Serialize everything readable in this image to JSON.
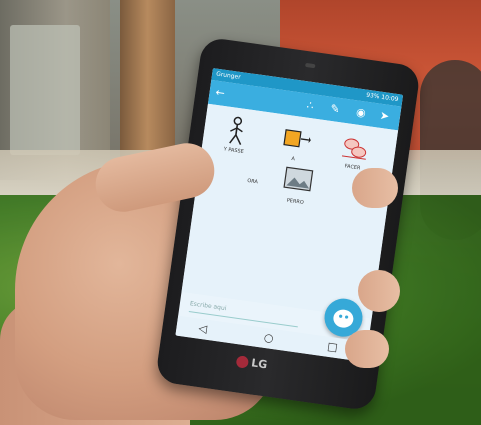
{
  "phone": {
    "status": {
      "app_name": "Grunger",
      "right": "93% 10:09"
    },
    "app_bar_icons": [
      "back-arrow-icon",
      "share-icon",
      "pencil-icon",
      "eye-icon",
      "pin-icon"
    ],
    "pictograms": [
      {
        "label": "Y PASSE"
      },
      {
        "label": "A"
      },
      {
        "label": "FACER"
      },
      {
        "label": "ORA"
      },
      {
        "label": "PERRO"
      }
    ],
    "input": {
      "placeholder": "Escribe aqui"
    },
    "nav_icons": [
      "back-triangle-icon",
      "home-circle-icon",
      "recent-square-icon"
    ],
    "brand": "LG"
  }
}
